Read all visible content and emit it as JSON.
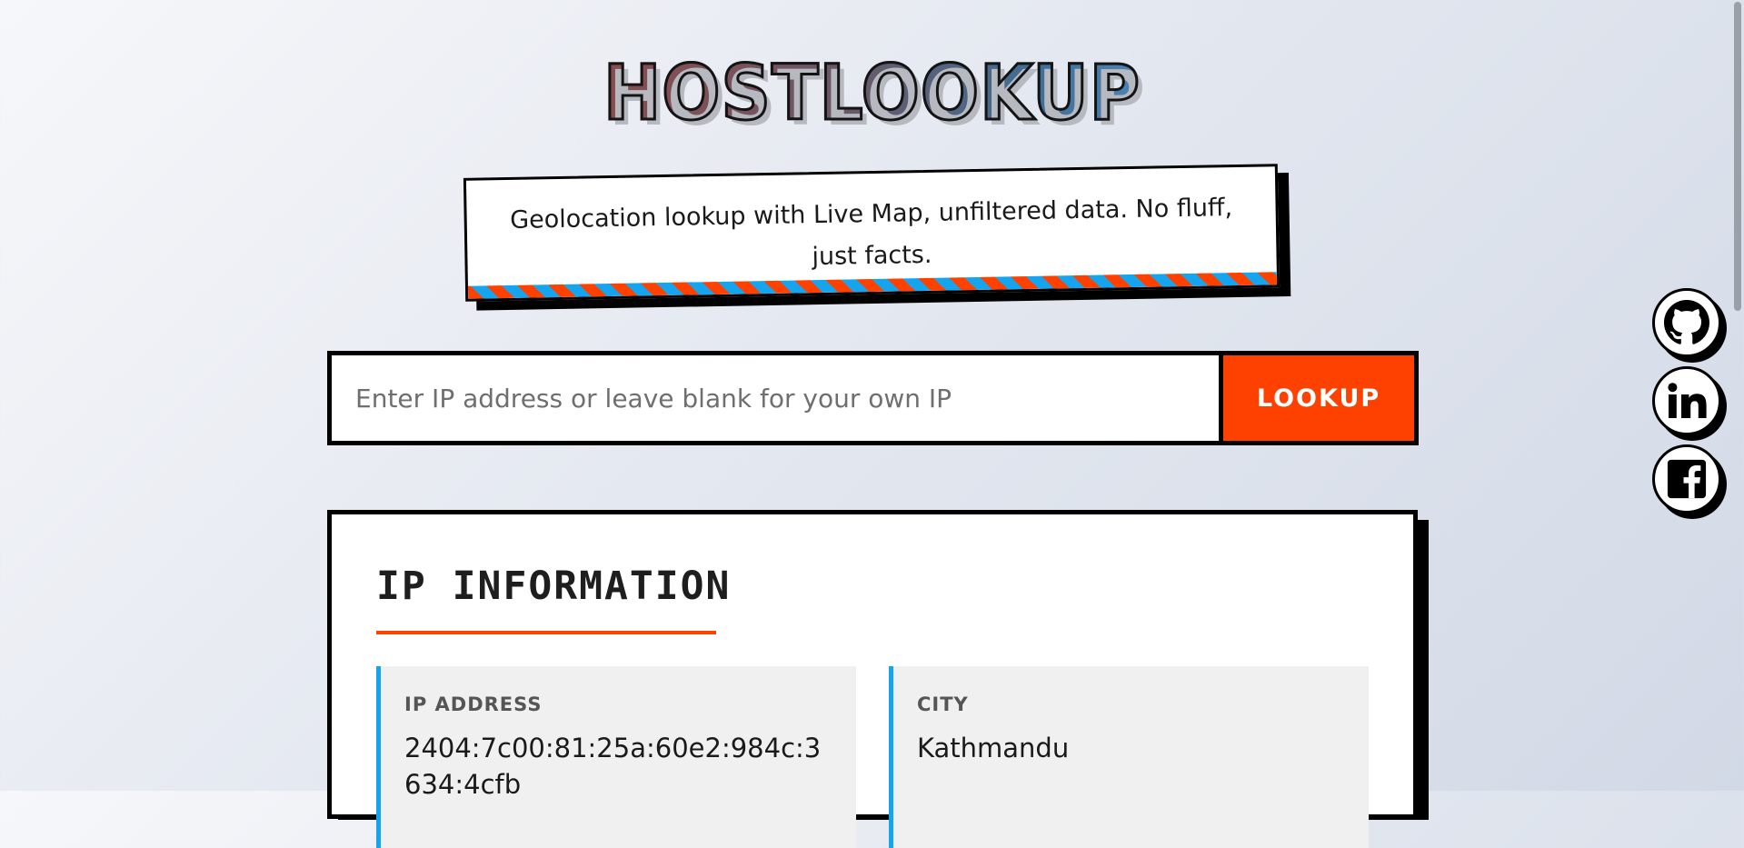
{
  "app": {
    "title": "HOSTLOOKUP",
    "tagline": "Geolocation lookup with Live Map, unfiltered data. No fluff, just facts."
  },
  "search": {
    "placeholder": "Enter IP address or leave blank for your own IP",
    "value": "",
    "button_label": "LOOKUP"
  },
  "ip_info": {
    "title": "IP INFORMATION",
    "fields": [
      {
        "label": "IP ADDRESS",
        "value": "2404:7c00:81:25a:60e2:984c:3634:4cfb"
      },
      {
        "label": "CITY",
        "value": "Kathmandu"
      }
    ]
  },
  "social": [
    {
      "name": "github",
      "icon": "github-icon"
    },
    {
      "name": "linkedin",
      "icon": "linkedin-icon"
    },
    {
      "name": "facebook",
      "icon": "facebook-icon"
    }
  ],
  "colors": {
    "accent": "#ff4100",
    "secondary": "#15a5ee",
    "ink": "#000000"
  }
}
